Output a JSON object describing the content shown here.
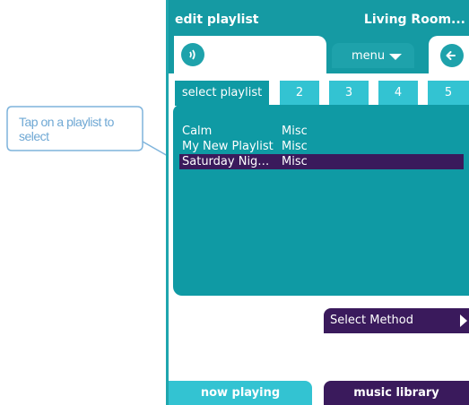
{
  "callout": {
    "text": "Tap on a playlist to select"
  },
  "title": {
    "left": "edit playlist",
    "right": "Living Room..."
  },
  "toolbar": {
    "menu_label": "menu",
    "speaker_icon": "speaker-icon",
    "back_icon": "back-arrow-icon"
  },
  "tabs": [
    {
      "label": "select playlist",
      "active": true
    },
    {
      "label": "2",
      "active": false
    },
    {
      "label": "3",
      "active": false
    },
    {
      "label": "4",
      "active": false
    },
    {
      "label": "5",
      "active": false
    }
  ],
  "playlists": [
    {
      "name": "Calm",
      "category": "Misc",
      "selected": false
    },
    {
      "name": "My New Playlist",
      "category": "Misc",
      "selected": false
    },
    {
      "name": "Saturday Nig…",
      "category": "Misc",
      "selected": true
    }
  ],
  "select_method": {
    "label": "Select Method"
  },
  "bottom": {
    "now_playing": "now playing",
    "music_library": "music library"
  },
  "colors": {
    "teal": "#159aa3",
    "light_teal": "#33c3d2",
    "purple": "#3a1a5c",
    "callout": "#6fa8d4"
  }
}
